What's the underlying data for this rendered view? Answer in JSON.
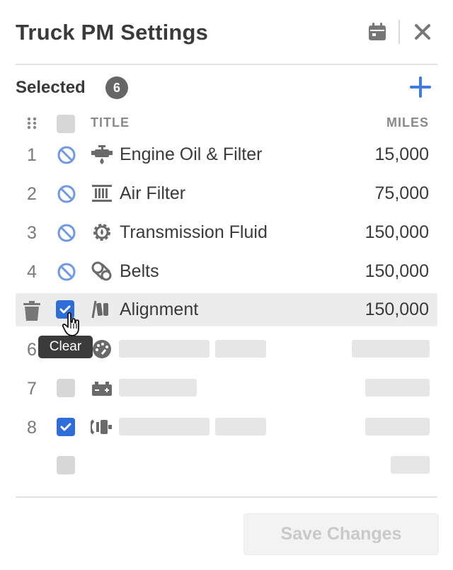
{
  "header": {
    "title": "Truck PM Settings"
  },
  "selected": {
    "label": "Selected",
    "count": "6"
  },
  "columns": {
    "title": "TITLE",
    "miles": "MILES"
  },
  "rows": [
    {
      "num": "1",
      "title": "Engine Oil & Filter",
      "miles": "15,000",
      "status": "excluded",
      "icon": "engine-oil-icon"
    },
    {
      "num": "2",
      "title": "Air Filter",
      "miles": "75,000",
      "status": "excluded",
      "icon": "air-filter-icon"
    },
    {
      "num": "3",
      "title": "Transmission Fluid",
      "miles": "150,000",
      "status": "excluded",
      "icon": "transmission-gear-icon"
    },
    {
      "num": "4",
      "title": "Belts",
      "miles": "150,000",
      "status": "excluded",
      "icon": "belts-icon"
    },
    {
      "num": "",
      "title": "Alignment",
      "miles": "150,000",
      "status": "checked",
      "icon": "alignment-icon"
    },
    {
      "num": "6",
      "title": "",
      "miles": "",
      "status": "placeholder",
      "icon": "gauge-icon"
    },
    {
      "num": "7",
      "title": "",
      "miles": "",
      "status": "placeholder",
      "icon": "battery-icon"
    },
    {
      "num": "8",
      "title": "",
      "miles": "",
      "status": "placeholder",
      "icon": "brake-icon"
    }
  ],
  "tooltip": {
    "text": "Clear"
  },
  "footer": {
    "save_label": "Save Changes"
  },
  "colors": {
    "accent": "#2f6ed9",
    "ban": "#6f99e6",
    "muted": "#8a8a8a",
    "skeleton": "#e6e6e6"
  }
}
